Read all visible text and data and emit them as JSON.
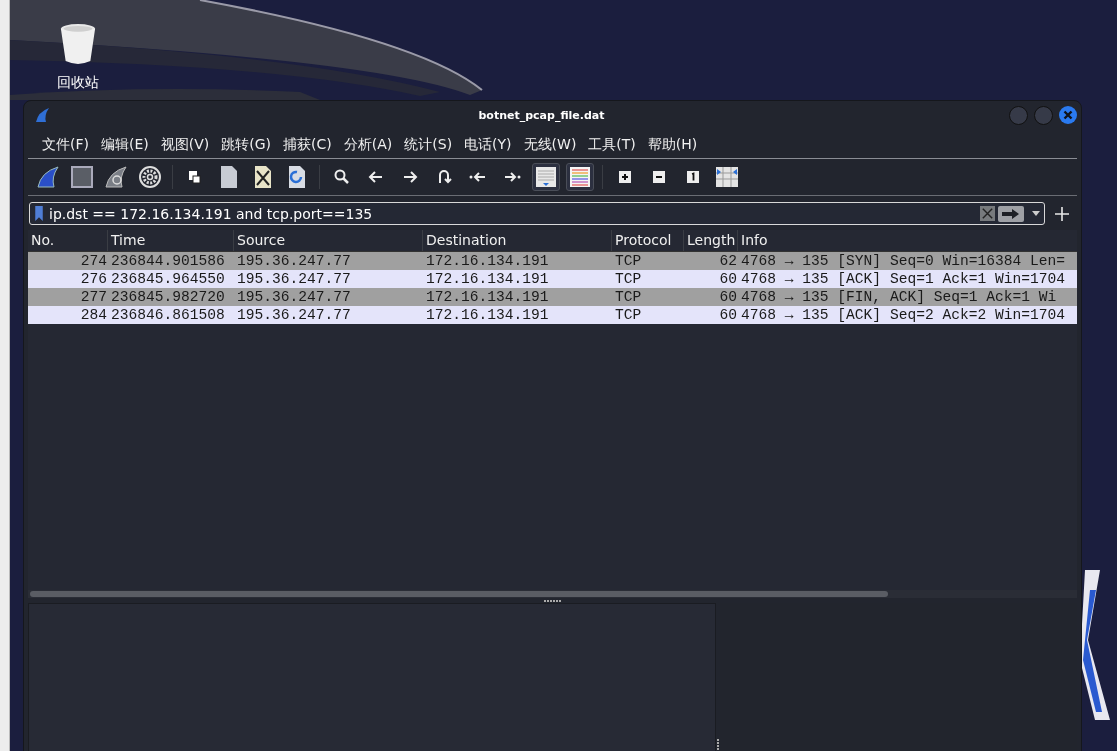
{
  "desktop": {
    "icons": [
      {
        "label": "回收站"
      }
    ]
  },
  "window": {
    "title": "botnet_pcap_file.dat"
  },
  "menu": [
    "文件(F)",
    "编辑(E)",
    "视图(V)",
    "跳转(G)",
    "捕获(C)",
    "分析(A)",
    "统计(S)",
    "电话(Y)",
    "无线(W)",
    "工具(T)",
    "帮助(H)"
  ],
  "toolbar": {
    "auto_scroll": {
      "on": true
    },
    "colorize": {
      "on": true
    }
  },
  "filter": {
    "value": "ip.dst == 172.16.134.191 and tcp.port==135"
  },
  "table": {
    "columns": [
      "No.",
      "Time",
      "Source",
      "Destination",
      "Protocol",
      "Length",
      "Info"
    ],
    "rows": [
      {
        "color": "#a0a0a0",
        "cells": [
          "274",
          "236844.901586",
          "195.36.247.77",
          "172.16.134.191",
          "TCP",
          "62",
          "4768 → 135 [SYN] Seq=0 Win=16384 Len="
        ]
      },
      {
        "color": "#e4e4fa",
        "cells": [
          "276",
          "236845.964550",
          "195.36.247.77",
          "172.16.134.191",
          "TCP",
          "60",
          "4768 → 135 [ACK] Seq=1 Ack=1 Win=1704"
        ]
      },
      {
        "color": "#a0a0a0",
        "cells": [
          "277",
          "236845.982720",
          "195.36.247.77",
          "172.16.134.191",
          "TCP",
          "60",
          "4768 → 135 [FIN, ACK] Seq=1 Ack=1 Wi"
        ]
      },
      {
        "color": "#e4e4fa",
        "cells": [
          "284",
          "236846.861508",
          "195.36.247.77",
          "172.16.134.191",
          "TCP",
          "60",
          "4768 → 135 [ACK] Seq=2 Ack=2 Win=1704"
        ]
      }
    ]
  }
}
